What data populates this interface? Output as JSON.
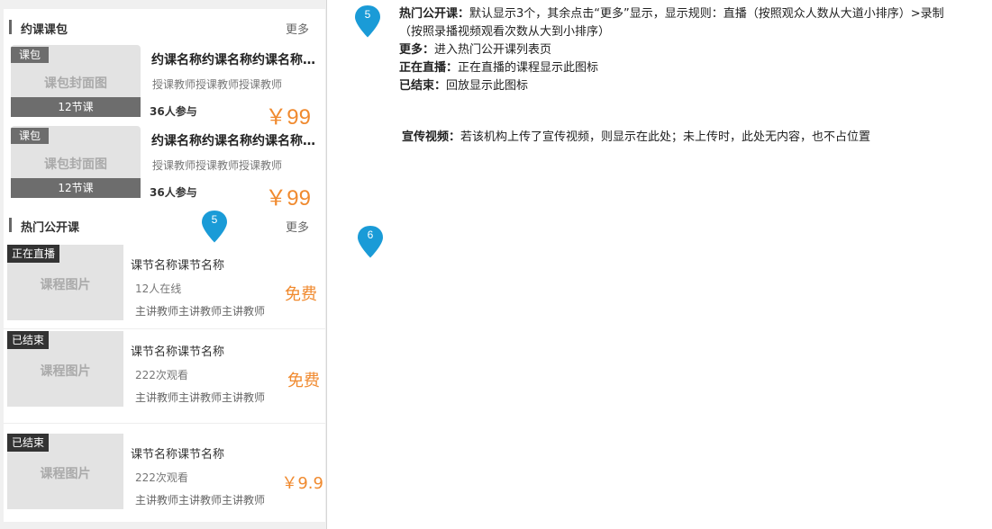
{
  "packages_section": {
    "title": "约课课包",
    "more": "更多",
    "items": [
      {
        "tag": "课包",
        "cover": "课包封面图",
        "lessons": "12节课",
        "name": "约课名称约课名称约课名称约课名称",
        "teacher": "授课教师授课教师授课教师",
        "join": "36人参与",
        "price": "￥99"
      },
      {
        "tag": "课包",
        "cover": "课包封面图",
        "lessons": "12节课",
        "name": "约课名称约课名称约课名称约课名称",
        "teacher": "授课教师授课教师授课教师",
        "join": "36人参与",
        "price": "￥99"
      }
    ]
  },
  "courses_section": {
    "title": "热门公开课",
    "more": "更多",
    "items": [
      {
        "tag": "正在直播",
        "image": "课程图片",
        "name": "课节名称课节名称",
        "stat": "12人在线",
        "teacher": "主讲教师主讲教师主讲教师",
        "price": "免费"
      },
      {
        "tag": "已结束",
        "image": "课程图片",
        "name": "课节名称课节名称",
        "stat": "222次观看",
        "teacher": "主讲教师主讲教师主讲教师",
        "price": "免费"
      },
      {
        "tag": "已结束",
        "image": "课程图片",
        "name": "课节名称课节名称",
        "stat": "222次观看",
        "teacher": "主讲教师主讲教师主讲教师",
        "price": "￥9.9"
      }
    ]
  },
  "markers": [
    {
      "label": "5"
    },
    {
      "label": "5"
    },
    {
      "label": "6"
    }
  ],
  "annotations": {
    "hot_label": "热门公开课：",
    "hot_line1": "默认显示3个，其余点击“更多”显示，显示规则：直播（按照观众人数从大道小排序）>录制",
    "hot_line2": "（按照录播视频观看次数从大到小排序）",
    "more_label": "更多：",
    "more_text": "进入热门公开课列表页",
    "live_label": "正在直播：",
    "live_text": "正在直播的课程显示此图标",
    "ended_label": "已结束：",
    "ended_text": "回放显示此图标",
    "video_label": "宣传视频：",
    "video_text": "若该机构上传了宣传视频，则显示在此处；未上传时，此处无内容，也不占位置"
  },
  "colors": {
    "accent": "#f08a2f",
    "marker": "#1a9bd7"
  }
}
